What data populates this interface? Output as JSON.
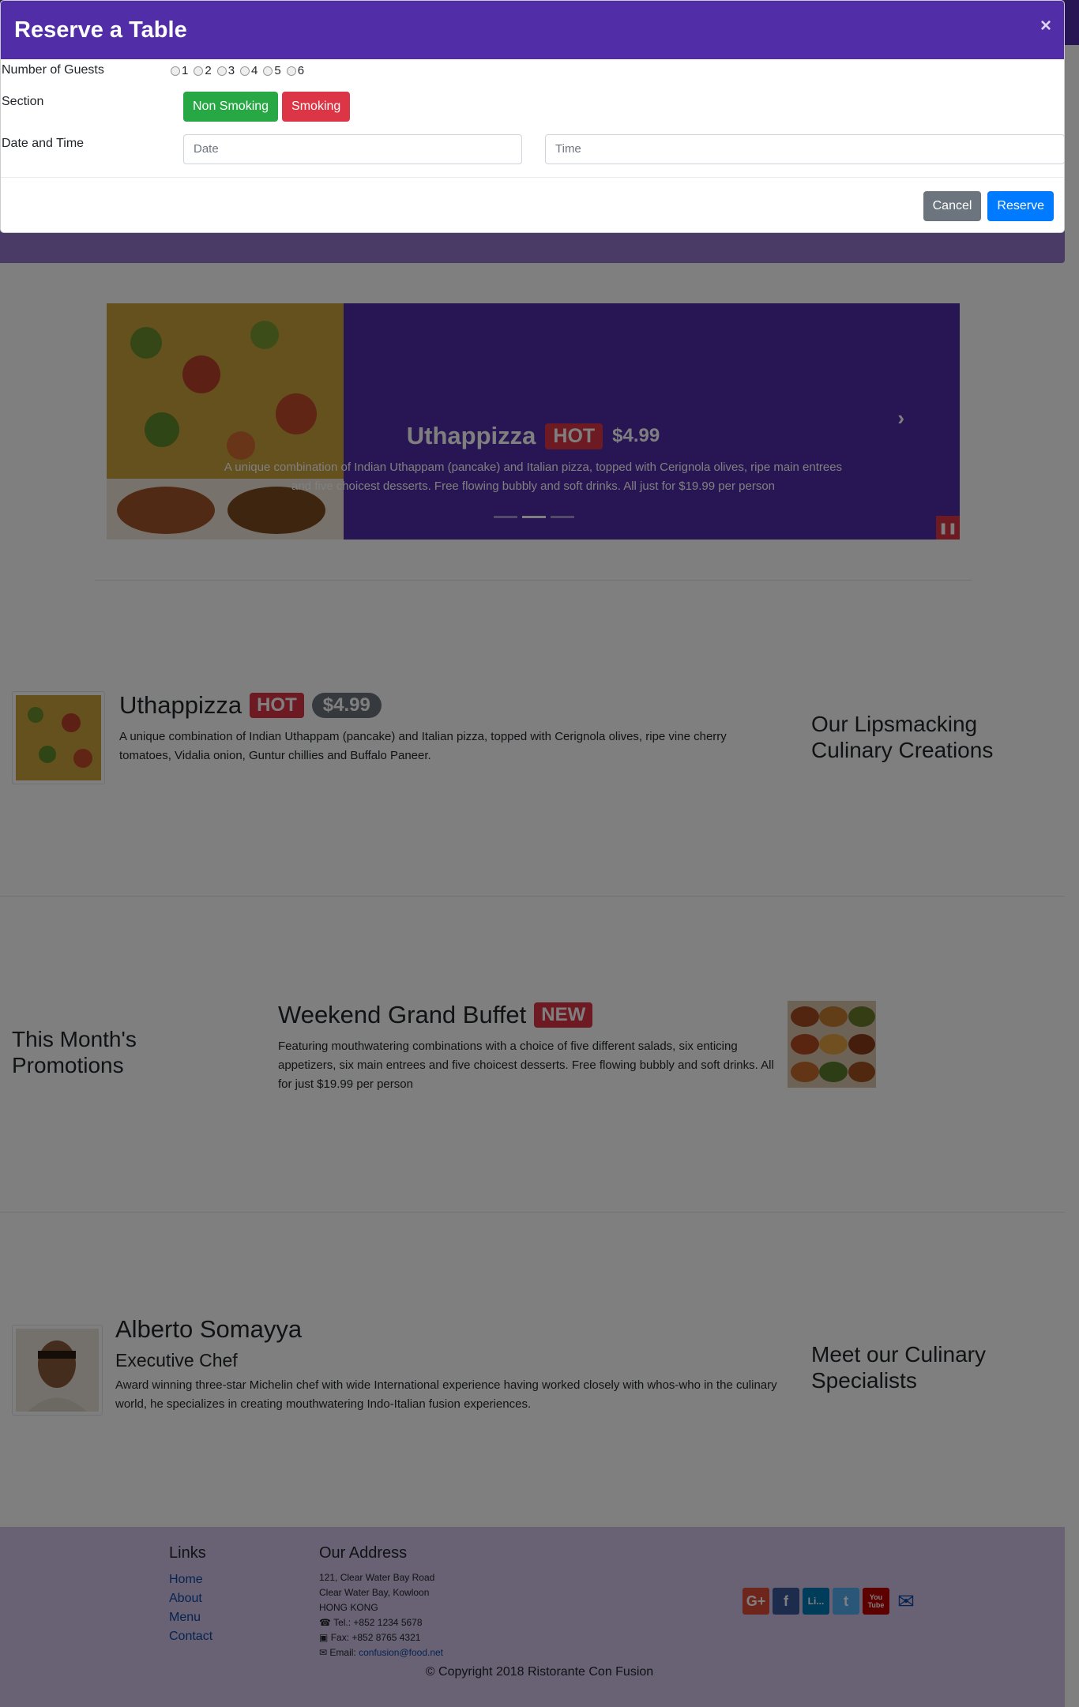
{
  "modal": {
    "title": "Reserve a Table",
    "close_label": "×",
    "guests_label": "Number of Guests",
    "guest_options": [
      "1",
      "2",
      "3",
      "4",
      "5",
      "6"
    ],
    "section_label": "Section",
    "non_smoking_label": "Non Smoking",
    "smoking_label": "Smoking",
    "datetime_label": "Date and Time",
    "date_placeholder": "Date",
    "time_placeholder": "Time",
    "cancel_label": "Cancel",
    "reserve_label": "Reserve"
  },
  "carousel": {
    "title": "Uthappizza",
    "badge": "HOT",
    "price": "$4.99",
    "text": "A unique combination of Indian Uthappam (pancake) and Italian pizza, topped with Cerignola olives, ripe main entrees and five choicest desserts. Free flowing bubbly and soft drinks. All just for $19.99 per person"
  },
  "dish": {
    "title": "Uthappizza",
    "badge": "HOT",
    "price": "$4.99",
    "text": "A unique combination of Indian Uthappam (pancake) and Italian pizza, topped with Cerignola olives, ripe vine cherry tomatoes, Vidalia onion, Guntur chillies and Buffalo Paneer.",
    "side_heading": "Our Lipsmacking Culinary Creations"
  },
  "promo": {
    "side_heading": "This Month's Promotions",
    "title": "Weekend Grand Buffet",
    "badge": "NEW",
    "text": "Featuring mouthwatering combinations with a choice of five different salads, six enticing appetizers, six main entrees and five choicest desserts. Free flowing bubbly and soft drinks. All for just $19.99 per person"
  },
  "leader": {
    "name": "Alberto Somayya",
    "designation": "Executive Chef",
    "text": "Award winning three-star Michelin chef with wide International experience having worked closely with whos-who in the culinary world, he specializes in creating mouthwatering Indo-Italian fusion experiences.",
    "side_heading": "Meet our Culinary Specialists"
  },
  "footer": {
    "links_heading": "Links",
    "links": [
      "Home",
      "About",
      "Menu",
      "Contact"
    ],
    "address_heading": "Our Address",
    "address_lines": [
      "121, Clear Water Bay Road",
      "Clear Water Bay, Kowloon",
      "HONG KONG"
    ],
    "tel": "Tel.: +852 1234 5678",
    "fax": "Fax: +852 8765 4321",
    "email_label": "Email: ",
    "email": "confusion@food.net",
    "social": [
      "G+",
      "f",
      "Li...",
      "t",
      "You Tube",
      "✉"
    ],
    "copyright": "© Copyright 2018 Ristorante Con Fusion"
  },
  "colors": {
    "primary": "#512da8",
    "light": "#9575cd",
    "footer": "#d1c4e9",
    "danger": "#dc3545",
    "success": "#28a745"
  }
}
